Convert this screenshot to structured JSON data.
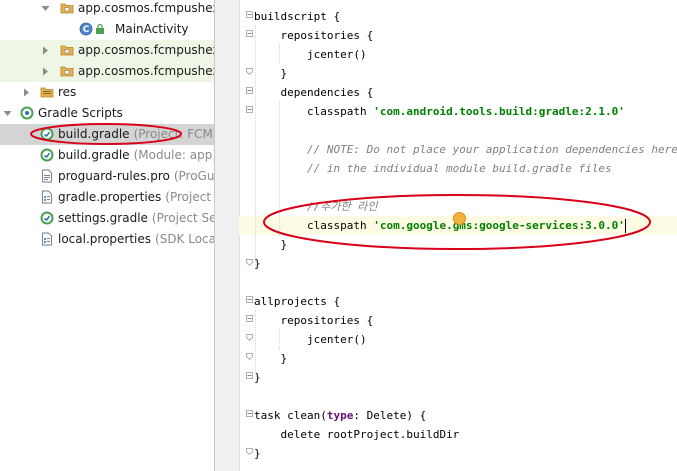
{
  "project_tree": {
    "items": [
      {
        "label": "app.cosmos.fcmpushexar",
        "hint": ""
      },
      {
        "label": "MainActivity",
        "hint": ""
      },
      {
        "label": "app.cosmos.fcmpushexar",
        "hint": ""
      },
      {
        "label": "app.cosmos.fcmpushexar",
        "hint": ""
      },
      {
        "label": "res",
        "hint": ""
      },
      {
        "label": "Gradle Scripts",
        "hint": ""
      },
      {
        "label": "build.gradle",
        "hint": "(Project: FCMPu"
      },
      {
        "label": "build.gradle",
        "hint": "(Module: app)"
      },
      {
        "label": "proguard-rules.pro",
        "hint": "(ProGuard"
      },
      {
        "label": "gradle.properties",
        "hint": "(Project Pro"
      },
      {
        "label": "settings.gradle",
        "hint": "(Project Settin"
      },
      {
        "label": "local.properties",
        "hint": "(SDK Locatio"
      }
    ],
    "icons": [
      "package-folder-icon",
      "class-icon",
      "package-folder-icon",
      "package-folder-icon",
      "resource-folder-icon",
      "gradle-scripts-icon",
      "gradle-file-icon",
      "gradle-file-icon",
      "text-file-icon",
      "properties-file-icon",
      "gradle-file-icon",
      "properties-file-icon"
    ]
  },
  "editor": {
    "lines": [
      {
        "indent": "",
        "segments": [
          {
            "t": "buildscript {",
            "c": "plain"
          }
        ]
      },
      {
        "indent": "    ",
        "segments": [
          {
            "t": "repositories {",
            "c": "plain"
          }
        ]
      },
      {
        "indent": "        ",
        "segments": [
          {
            "t": "jcenter()",
            "c": "plain"
          }
        ]
      },
      {
        "indent": "    ",
        "segments": [
          {
            "t": "}",
            "c": "plain"
          }
        ]
      },
      {
        "indent": "    ",
        "segments": [
          {
            "t": "dependencies {",
            "c": "plain"
          }
        ]
      },
      {
        "indent": "        ",
        "segments": [
          {
            "t": "classpath ",
            "c": "plain"
          },
          {
            "t": "'com.android.tools.build:gradle:2.1.0'",
            "c": "str"
          }
        ]
      },
      {
        "indent": "",
        "segments": []
      },
      {
        "indent": "        ",
        "segments": [
          {
            "t": "// NOTE: Do not place your application dependencies here; they",
            "c": "cmt"
          }
        ]
      },
      {
        "indent": "        ",
        "segments": [
          {
            "t": "// in the individual module build.gradle files",
            "c": "cmt"
          }
        ]
      },
      {
        "indent": "",
        "segments": []
      },
      {
        "indent": "        ",
        "segments": [
          {
            "t": "//추가한 라인",
            "c": "cmt"
          }
        ]
      },
      {
        "indent": "        ",
        "segments": [
          {
            "t": "classpath ",
            "c": "plain"
          },
          {
            "t": "'com.google.gms:google-services:3.0.0'",
            "c": "str"
          }
        ],
        "caret": true
      },
      {
        "indent": "    ",
        "segments": [
          {
            "t": "}",
            "c": "plain"
          }
        ]
      },
      {
        "indent": "",
        "segments": [
          {
            "t": "}",
            "c": "plain"
          }
        ]
      },
      {
        "indent": "",
        "segments": []
      },
      {
        "indent": "",
        "segments": [
          {
            "t": "allprojects {",
            "c": "plain"
          }
        ]
      },
      {
        "indent": "    ",
        "segments": [
          {
            "t": "repositories {",
            "c": "plain"
          }
        ]
      },
      {
        "indent": "        ",
        "segments": [
          {
            "t": "jcenter()",
            "c": "plain"
          }
        ]
      },
      {
        "indent": "    ",
        "segments": [
          {
            "t": "}",
            "c": "plain"
          }
        ]
      },
      {
        "indent": "",
        "segments": [
          {
            "t": "}",
            "c": "plain"
          }
        ]
      },
      {
        "indent": "",
        "segments": []
      },
      {
        "indent": "",
        "segments": [
          {
            "t": "task clean(",
            "c": "plain"
          },
          {
            "t": "type",
            "c": "named"
          },
          {
            "t": ": Delete) {",
            "c": "plain"
          }
        ]
      },
      {
        "indent": "    ",
        "segments": [
          {
            "t": "delete rootProject.buildDir",
            "c": "plain"
          }
        ]
      },
      {
        "indent": "",
        "segments": [
          {
            "t": "}",
            "c": "plain"
          }
        ]
      }
    ]
  },
  "colors": {
    "annotation_circle": "#d9001a",
    "selection_bg": "#d4d4d4",
    "caret_line_bg": "#fefbe5",
    "string_green": "#008000",
    "comment_gray": "#808080"
  }
}
